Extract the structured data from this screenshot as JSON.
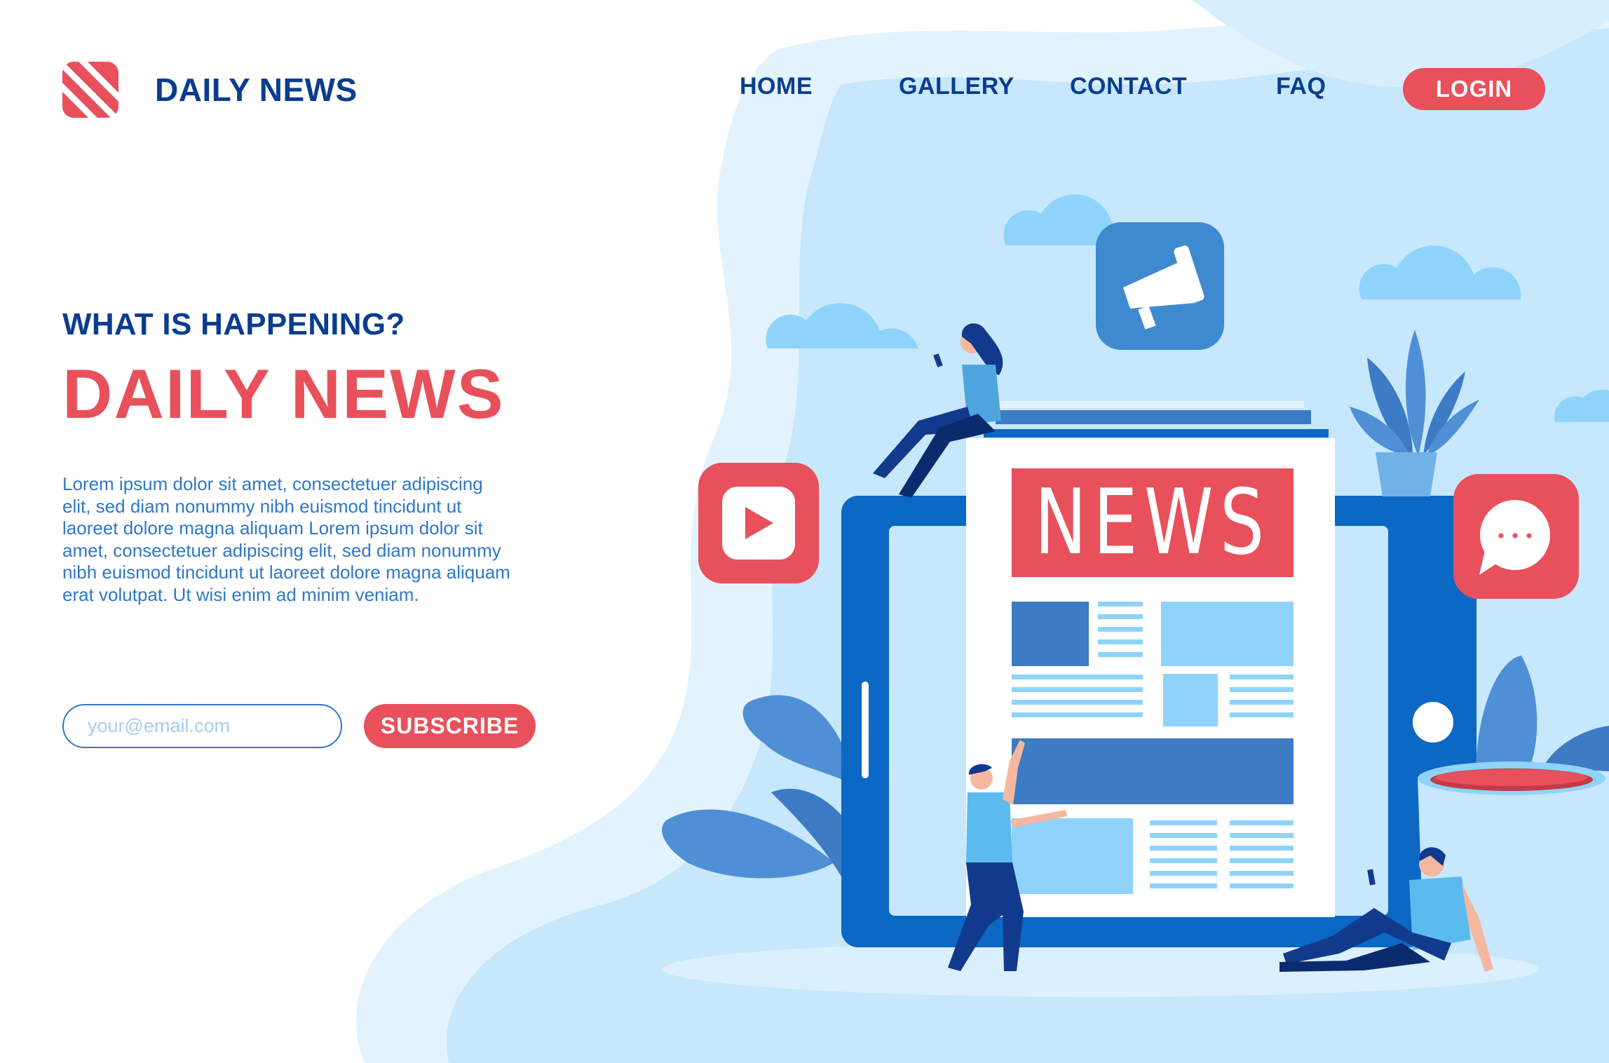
{
  "brand": {
    "name": "DAILY NEWS"
  },
  "nav": {
    "items": [
      {
        "label": "HOME"
      },
      {
        "label": "GALLERY"
      },
      {
        "label": "CONTACT"
      },
      {
        "label": "FAQ"
      }
    ],
    "login_label": "LOGIN"
  },
  "hero": {
    "tagline": "WHAT IS HAPPENING?",
    "headline": "DAILY NEWS",
    "body": "Lorem ipsum dolor sit amet, consectetuer adipiscing elit, sed diam nonummy nibh euismod tincidunt ut laoreet dolore magna aliquam Lorem ipsum dolor sit amet, consectetuer adipiscing elit, sed diam nonummy nibh euismod tincidunt ut laoreet dolore magna aliquam erat volutpat. Ut wisi enim ad minim veniam."
  },
  "signup": {
    "email_placeholder": "your@email.com",
    "subscribe_label": "SUBSCRIBE"
  },
  "illustration": {
    "newspaper_title": "NEWS",
    "icons": [
      "megaphone-icon",
      "play-icon",
      "chat-bubble-icon"
    ]
  },
  "colors": {
    "accent": "#e8505b",
    "navy": "#0a3d8f",
    "blue": "#2e78c7",
    "light_blue": "#bfe3fb"
  }
}
